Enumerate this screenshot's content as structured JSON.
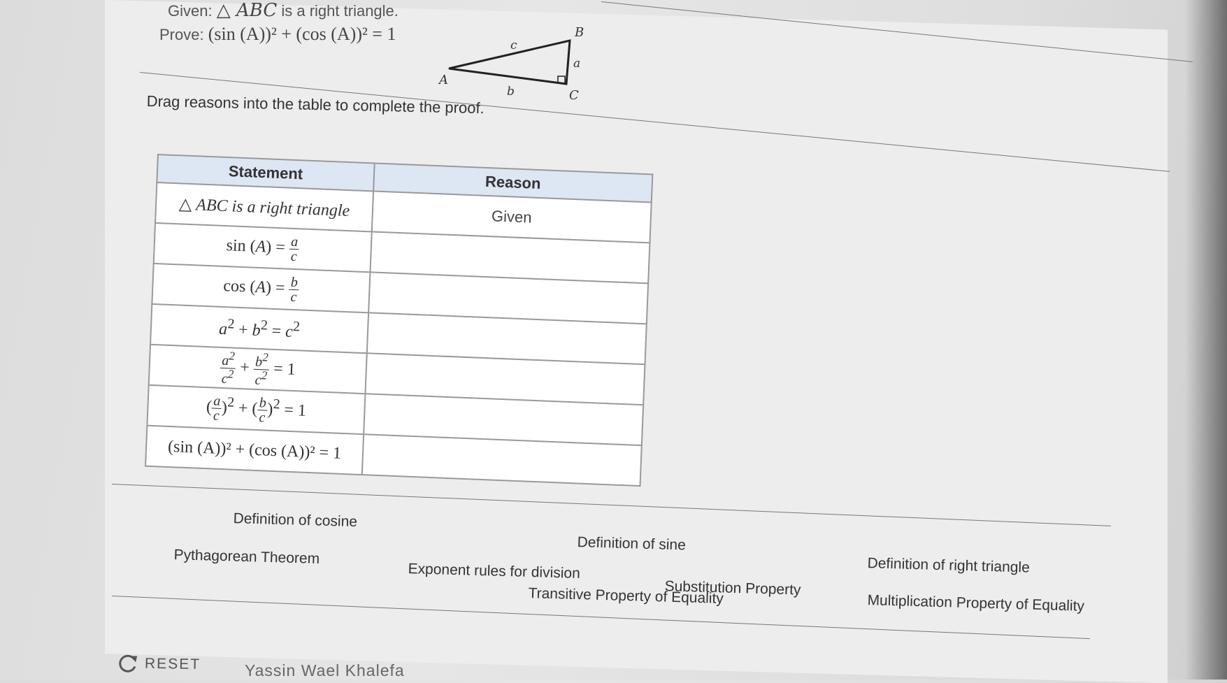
{
  "problem": {
    "given_label": "Given:",
    "given_text": "is a right triangle.",
    "given_triangle": "△ ABC",
    "prove_label": "Prove:",
    "prove_expr": "(sin (A))² + (cos (A))² = 1"
  },
  "figure": {
    "vertex_a": "A",
    "vertex_b": "B",
    "vertex_c": "C",
    "side_a": "a",
    "side_b": "b",
    "side_c": "c"
  },
  "instruction": "Drag reasons into the table to complete the proof.",
  "table": {
    "header_statement": "Statement",
    "header_reason": "Reason",
    "rows": [
      {
        "statement": "ABC is a right triangle",
        "reason": "Given"
      },
      {
        "statement": "sin (A) = a/c",
        "reason": ""
      },
      {
        "statement": "cos (A) = b/c",
        "reason": ""
      },
      {
        "statement": "a² + b² = c²",
        "reason": ""
      },
      {
        "statement": "a²/c² + b²/c² = 1",
        "reason": ""
      },
      {
        "statement": "(a/c)² + (b/c)² = 1",
        "reason": ""
      },
      {
        "statement": "(sin (A))² + (cos (A))² = 1",
        "reason": ""
      }
    ]
  },
  "reason_bank": [
    "Definition of cosine",
    "Definition of sine",
    "Definition of right triangle",
    "Pythagorean Theorem",
    "Exponent rules for division",
    "Substitution Property",
    "Transitive Property of Equality",
    "Multiplication Property of Equality"
  ],
  "footer": {
    "reset_label": "RESET",
    "student_name": "Yassin Wael Khalefa"
  }
}
